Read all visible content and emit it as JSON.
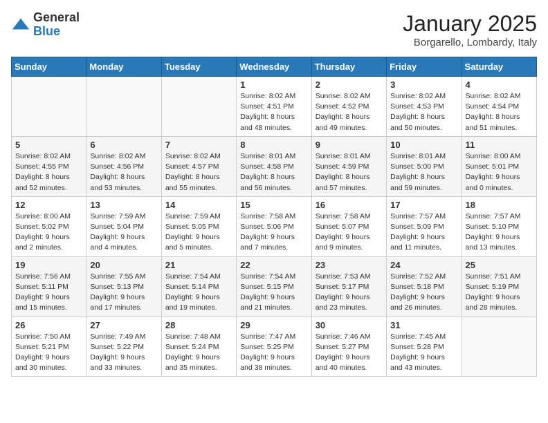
{
  "header": {
    "logo_general": "General",
    "logo_blue": "Blue",
    "month_title": "January 2025",
    "location": "Borgarello, Lombardy, Italy"
  },
  "weekdays": [
    "Sunday",
    "Monday",
    "Tuesday",
    "Wednesday",
    "Thursday",
    "Friday",
    "Saturday"
  ],
  "weeks": [
    [
      {
        "day": "",
        "sunrise": "",
        "sunset": "",
        "daylight": ""
      },
      {
        "day": "",
        "sunrise": "",
        "sunset": "",
        "daylight": ""
      },
      {
        "day": "",
        "sunrise": "",
        "sunset": "",
        "daylight": ""
      },
      {
        "day": "1",
        "sunrise": "Sunrise: 8:02 AM",
        "sunset": "Sunset: 4:51 PM",
        "daylight": "Daylight: 8 hours and 48 minutes."
      },
      {
        "day": "2",
        "sunrise": "Sunrise: 8:02 AM",
        "sunset": "Sunset: 4:52 PM",
        "daylight": "Daylight: 8 hours and 49 minutes."
      },
      {
        "day": "3",
        "sunrise": "Sunrise: 8:02 AM",
        "sunset": "Sunset: 4:53 PM",
        "daylight": "Daylight: 8 hours and 50 minutes."
      },
      {
        "day": "4",
        "sunrise": "Sunrise: 8:02 AM",
        "sunset": "Sunset: 4:54 PM",
        "daylight": "Daylight: 8 hours and 51 minutes."
      }
    ],
    [
      {
        "day": "5",
        "sunrise": "Sunrise: 8:02 AM",
        "sunset": "Sunset: 4:55 PM",
        "daylight": "Daylight: 8 hours and 52 minutes."
      },
      {
        "day": "6",
        "sunrise": "Sunrise: 8:02 AM",
        "sunset": "Sunset: 4:56 PM",
        "daylight": "Daylight: 8 hours and 53 minutes."
      },
      {
        "day": "7",
        "sunrise": "Sunrise: 8:02 AM",
        "sunset": "Sunset: 4:57 PM",
        "daylight": "Daylight: 8 hours and 55 minutes."
      },
      {
        "day": "8",
        "sunrise": "Sunrise: 8:01 AM",
        "sunset": "Sunset: 4:58 PM",
        "daylight": "Daylight: 8 hours and 56 minutes."
      },
      {
        "day": "9",
        "sunrise": "Sunrise: 8:01 AM",
        "sunset": "Sunset: 4:59 PM",
        "daylight": "Daylight: 8 hours and 57 minutes."
      },
      {
        "day": "10",
        "sunrise": "Sunrise: 8:01 AM",
        "sunset": "Sunset: 5:00 PM",
        "daylight": "Daylight: 8 hours and 59 minutes."
      },
      {
        "day": "11",
        "sunrise": "Sunrise: 8:00 AM",
        "sunset": "Sunset: 5:01 PM",
        "daylight": "Daylight: 9 hours and 0 minutes."
      }
    ],
    [
      {
        "day": "12",
        "sunrise": "Sunrise: 8:00 AM",
        "sunset": "Sunset: 5:02 PM",
        "daylight": "Daylight: 9 hours and 2 minutes."
      },
      {
        "day": "13",
        "sunrise": "Sunrise: 7:59 AM",
        "sunset": "Sunset: 5:04 PM",
        "daylight": "Daylight: 9 hours and 4 minutes."
      },
      {
        "day": "14",
        "sunrise": "Sunrise: 7:59 AM",
        "sunset": "Sunset: 5:05 PM",
        "daylight": "Daylight: 9 hours and 5 minutes."
      },
      {
        "day": "15",
        "sunrise": "Sunrise: 7:58 AM",
        "sunset": "Sunset: 5:06 PM",
        "daylight": "Daylight: 9 hours and 7 minutes."
      },
      {
        "day": "16",
        "sunrise": "Sunrise: 7:58 AM",
        "sunset": "Sunset: 5:07 PM",
        "daylight": "Daylight: 9 hours and 9 minutes."
      },
      {
        "day": "17",
        "sunrise": "Sunrise: 7:57 AM",
        "sunset": "Sunset: 5:09 PM",
        "daylight": "Daylight: 9 hours and 11 minutes."
      },
      {
        "day": "18",
        "sunrise": "Sunrise: 7:57 AM",
        "sunset": "Sunset: 5:10 PM",
        "daylight": "Daylight: 9 hours and 13 minutes."
      }
    ],
    [
      {
        "day": "19",
        "sunrise": "Sunrise: 7:56 AM",
        "sunset": "Sunset: 5:11 PM",
        "daylight": "Daylight: 9 hours and 15 minutes."
      },
      {
        "day": "20",
        "sunrise": "Sunrise: 7:55 AM",
        "sunset": "Sunset: 5:13 PM",
        "daylight": "Daylight: 9 hours and 17 minutes."
      },
      {
        "day": "21",
        "sunrise": "Sunrise: 7:54 AM",
        "sunset": "Sunset: 5:14 PM",
        "daylight": "Daylight: 9 hours and 19 minutes."
      },
      {
        "day": "22",
        "sunrise": "Sunrise: 7:54 AM",
        "sunset": "Sunset: 5:15 PM",
        "daylight": "Daylight: 9 hours and 21 minutes."
      },
      {
        "day": "23",
        "sunrise": "Sunrise: 7:53 AM",
        "sunset": "Sunset: 5:17 PM",
        "daylight": "Daylight: 9 hours and 23 minutes."
      },
      {
        "day": "24",
        "sunrise": "Sunrise: 7:52 AM",
        "sunset": "Sunset: 5:18 PM",
        "daylight": "Daylight: 9 hours and 26 minutes."
      },
      {
        "day": "25",
        "sunrise": "Sunrise: 7:51 AM",
        "sunset": "Sunset: 5:19 PM",
        "daylight": "Daylight: 9 hours and 28 minutes."
      }
    ],
    [
      {
        "day": "26",
        "sunrise": "Sunrise: 7:50 AM",
        "sunset": "Sunset: 5:21 PM",
        "daylight": "Daylight: 9 hours and 30 minutes."
      },
      {
        "day": "27",
        "sunrise": "Sunrise: 7:49 AM",
        "sunset": "Sunset: 5:22 PM",
        "daylight": "Daylight: 9 hours and 33 minutes."
      },
      {
        "day": "28",
        "sunrise": "Sunrise: 7:48 AM",
        "sunset": "Sunset: 5:24 PM",
        "daylight": "Daylight: 9 hours and 35 minutes."
      },
      {
        "day": "29",
        "sunrise": "Sunrise: 7:47 AM",
        "sunset": "Sunset: 5:25 PM",
        "daylight": "Daylight: 9 hours and 38 minutes."
      },
      {
        "day": "30",
        "sunrise": "Sunrise: 7:46 AM",
        "sunset": "Sunset: 5:27 PM",
        "daylight": "Daylight: 9 hours and 40 minutes."
      },
      {
        "day": "31",
        "sunrise": "Sunrise: 7:45 AM",
        "sunset": "Sunset: 5:28 PM",
        "daylight": "Daylight: 9 hours and 43 minutes."
      },
      {
        "day": "",
        "sunrise": "",
        "sunset": "",
        "daylight": ""
      }
    ]
  ]
}
